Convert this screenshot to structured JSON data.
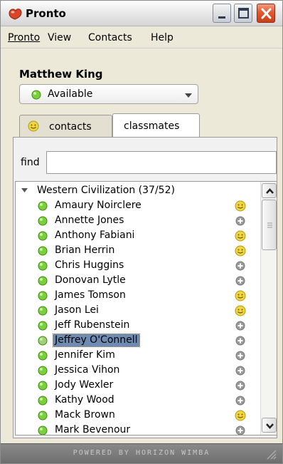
{
  "window": {
    "title": "Pronto"
  },
  "menu": {
    "pronto": "Pronto",
    "view": "View",
    "contacts": "Contacts",
    "help": "Help"
  },
  "user": {
    "name": "Matthew King",
    "status": "Available"
  },
  "tabs": {
    "contacts": "contacts",
    "classmates": "classmates"
  },
  "find": {
    "label": "find",
    "value": ""
  },
  "group": {
    "label": "Western Civilization (37/52)"
  },
  "members": [
    {
      "name": "Amaury Noirclere",
      "indicator": "smiley-icon"
    },
    {
      "name": "Annette Jones",
      "indicator": "plus-icon"
    },
    {
      "name": "Anthony Fabiani",
      "indicator": "smiley-icon"
    },
    {
      "name": "Brian Herrin",
      "indicator": "smiley-icon"
    },
    {
      "name": "Chris Huggins",
      "indicator": "plus-icon"
    },
    {
      "name": "Donovan Lytle",
      "indicator": "plus-icon"
    },
    {
      "name": "James Tomson",
      "indicator": "smiley-icon"
    },
    {
      "name": "Jason Lei",
      "indicator": "smiley-icon"
    },
    {
      "name": "Jeff Rubenstein",
      "indicator": "plus-icon"
    },
    {
      "name": "Jeffrey O'Connell",
      "indicator": "plus-icon",
      "selected": true
    },
    {
      "name": "Jennifer Kim",
      "indicator": "plus-icon"
    },
    {
      "name": "Jessica Vihon",
      "indicator": "plus-icon"
    },
    {
      "name": "Jody Wexler",
      "indicator": "plus-icon"
    },
    {
      "name": "Kathy Wood",
      "indicator": "plus-icon"
    },
    {
      "name": "Mack Brown",
      "indicator": "smiley-icon"
    },
    {
      "name": "Mark Bevenour",
      "indicator": "plus-icon"
    }
  ],
  "footer": {
    "text": "POWERED BY HORIZON WIMBA"
  },
  "colors": {
    "online": "#7ad03a",
    "smiley": "#f0d640",
    "selection": "#6e8bb2"
  }
}
